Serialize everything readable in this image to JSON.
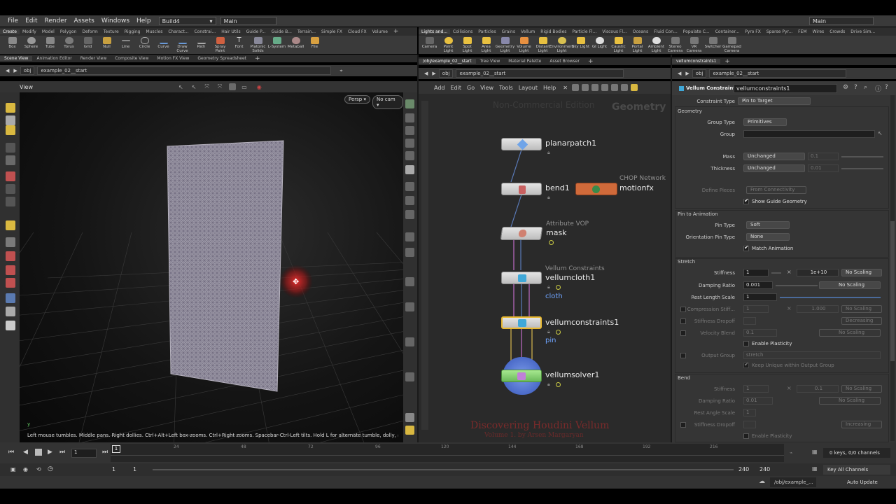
{
  "menubar": {
    "items": [
      "File",
      "Edit",
      "Render",
      "Assets",
      "Windows",
      "Help"
    ],
    "desktop": "Build4",
    "context": "Main",
    "right_context": "Main"
  },
  "shelf_left": {
    "tabs": [
      "Create",
      "Modify",
      "Model",
      "Polygon",
      "Deform",
      "Texture",
      "Rigging",
      "Muscles",
      "Charact...",
      "Constrai...",
      "Hair Utils",
      "Guide P...",
      "Guide B...",
      "Terrain...",
      "Simple FX",
      "Cloud FX",
      "Volume"
    ],
    "tools": [
      "Box",
      "Sphere",
      "Tube",
      "Torus",
      "Grid",
      "Null",
      "Line",
      "Circle",
      "Curve",
      "Draw Curve",
      "Path",
      "Spray Paint",
      "Font",
      "Platonic Solids",
      "L-System",
      "Metaball",
      "File"
    ]
  },
  "shelf_right": {
    "tabs": [
      "Lights and...",
      "Collisions",
      "Particles",
      "Grains",
      "Vellum",
      "Rigid Bodies",
      "Particle Fl...",
      "Viscous Fl...",
      "Oceans",
      "Fluid Con...",
      "Populate C...",
      "Container...",
      "Pyro FX",
      "Sparse Pyr...",
      "FEM",
      "Wires",
      "Crowds",
      "Drive Sim..."
    ],
    "tools": [
      "Camera",
      "Point Light",
      "Spot Light",
      "Area Light",
      "Geometry Light",
      "Volume Light",
      "Distant Light",
      "Environment Light",
      "Sky Light",
      "GI Light",
      "Caustic Light",
      "Portal Light",
      "Ambient Light",
      "Stereo Camera",
      "VR Camera",
      "Switcher",
      "Gamepad Camera"
    ]
  },
  "viewer": {
    "tabs": [
      "Scene View",
      "Animation Editor",
      "Render View",
      "Composite View",
      "Motion FX View",
      "Geometry Spreadsheet"
    ],
    "path_root": "obj",
    "path_node": "example_02__start",
    "title": "View",
    "persp": "Persp",
    "cam": "No cam",
    "status": "Left mouse tumbles. Middle pans. Right dollies. Ctrl+Alt+Left box-zooms. Ctrl+Right zooms. Spacebar-Ctrl-Left tilts. Hold L for alternate tumble, dolly, and zoom.",
    "axis_label": "y"
  },
  "network": {
    "tabs": [
      "/obj/example_02__start",
      "Tree View",
      "Material Palette",
      "Asset Browser"
    ],
    "path_root": "obj",
    "path_node": "example_02__start",
    "menu": [
      "Add",
      "Edit",
      "Go",
      "View",
      "Tools",
      "Layout",
      "Help"
    ],
    "watermark": "Non-Commercial Edition",
    "context_label": "Geometry",
    "nodes": [
      {
        "name": "planarpatch1",
        "type": "",
        "param": ""
      },
      {
        "name": "bend1",
        "type": "",
        "param": ""
      },
      {
        "name": "mask",
        "type": "Attribute VOP",
        "param": ""
      },
      {
        "name": "vellumcloth1",
        "type": "Vellum Constraints",
        "param": "cloth"
      },
      {
        "name": "vellumconstraints1",
        "type": "",
        "param": "pin"
      },
      {
        "name": "vellumsolver1",
        "type": "",
        "param": ""
      }
    ],
    "chop": {
      "name": "motionfx",
      "type": "CHOP Network"
    },
    "credit_title": "Discovering Houdini Vellum",
    "credit_sub": "Volume 1.  by Arsen Margaryan"
  },
  "params": {
    "path_root": "obj",
    "path_node": "example_02__start",
    "tab": "vellumconstraints1",
    "node_type": "Vellum Constraints",
    "node_name": "vellumconstraints1",
    "constraint_type_label": "Constraint Type",
    "constraint_type": "Pin to Target",
    "geometry_header": "Geometry",
    "group_type_label": "Group Type",
    "group_type": "Primitives",
    "group_label": "Group",
    "mass_label": "Mass",
    "mass": "Unchanged",
    "mass_val": "0.1",
    "thickness_label": "Thickness",
    "thickness": "Unchanged",
    "thickness_val": "0.01",
    "define_pieces_label": "Define Pieces",
    "define_pieces": "From Connectivity",
    "show_guide": "Show Guide Geometry",
    "pin_header": "Pin to Animation",
    "pin_type_label": "Pin Type",
    "pin_type": "Soft",
    "orient_pin_label": "Orientation Pin Type",
    "orient_pin": "None",
    "match_anim": "Match Animation",
    "stretch_header": "Stretch",
    "stiffness_label": "Stiffness",
    "stiffness": "1",
    "stiffness_mult": "1e+10",
    "no_scaling": "No Scaling",
    "damping_label": "Damping Ratio",
    "damping": "0.001",
    "rest_length_label": "Rest Length Scale",
    "rest_length": "1",
    "compression_label": "Compression Stiff...",
    "compression_val": "1",
    "compression_mult": "1.000",
    "stiff_dropoff_label": "Stiffness Dropoff",
    "decreasing": "Decreasing",
    "velocity_blend_label": "Velocity Blend",
    "velocity_blend": "0.1",
    "enable_plasticity": "Enable Plasticity",
    "output_group_label": "Output Group",
    "output_group": "stretch",
    "keep_unique": "Keep Unique within Output Group",
    "bend_header": "Bend",
    "bend_stiffness": "1",
    "bend_mult": "0.1",
    "bend_damping": "0.01",
    "rest_angle_label": "Rest Angle Scale",
    "rest_angle": "1",
    "increasing": "Increasing"
  },
  "timeline": {
    "frame": "1",
    "ticks": [
      "24",
      "48",
      "72",
      "96",
      "120",
      "144",
      "168",
      "192",
      "216"
    ],
    "start": "1",
    "start2": "1",
    "end": "240",
    "end2": "240",
    "keys": "0 keys, 0/0 channels",
    "key_all": "Key All Channels"
  },
  "statusbar": {
    "path": "/obj/example_...",
    "update": "Auto Update"
  }
}
